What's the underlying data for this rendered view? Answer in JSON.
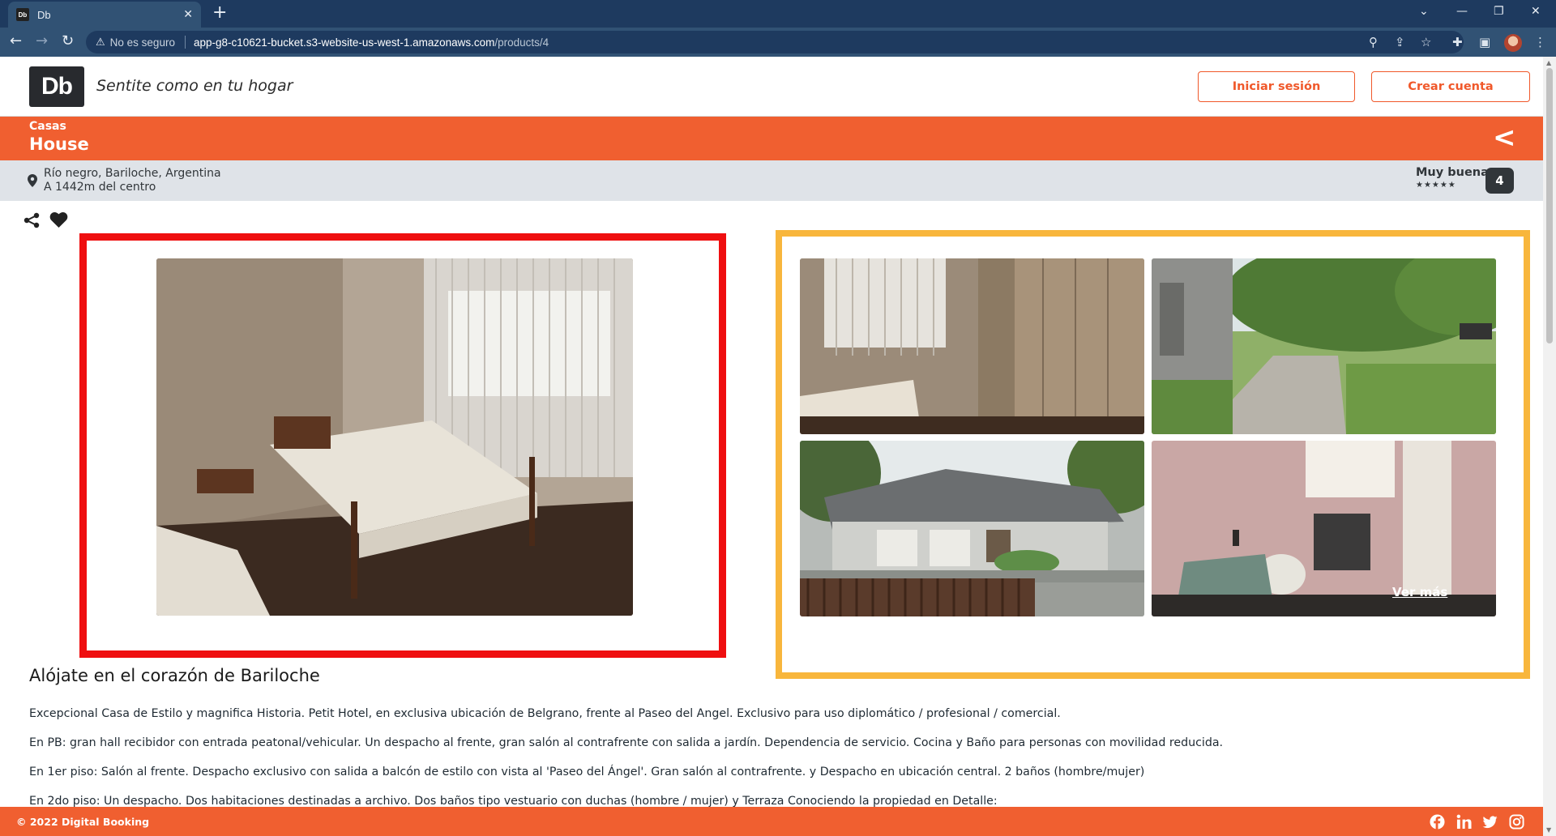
{
  "browser": {
    "tab_title": "Db",
    "tab_favicon": "Db",
    "new_tab_label": "+",
    "security_label": "No es seguro",
    "url_host": "app-g8-c10621-bucket.s3-website-us-west-1.amazonaws.com",
    "url_path": "/products/4"
  },
  "header": {
    "logo_text": "Db",
    "slogan": "Sentite como en tu hogar",
    "login_label": "Iniciar sesión",
    "signup_label": "Crear cuenta"
  },
  "product": {
    "category": "Casas",
    "name": "House",
    "location_line1": "Río negro, Bariloche, Argentina",
    "location_line2": "A 1442m del centro",
    "rating_text": "Muy buena",
    "stars": "★★★★★",
    "score": "4"
  },
  "gallery": {
    "more_label": "Ver más"
  },
  "description": {
    "title": "Alójate en el corazón de Bariloche",
    "paragraphs": [
      "Excepcional Casa de Estilo y magnifica Historia. Petit Hotel, en exclusiva ubicación de Belgrano, frente al Paseo del Angel. Exclusivo para uso diplomático / profesional / comercial.",
      "En PB: gran hall recibidor con entrada peatonal/vehicular. Un despacho al frente, gran salón al contrafrente con salida a jardín. Dependencia de servicio. Cocina y Baño para personas con movilidad reducida.",
      "En 1er piso: Salón al frente. Despacho exclusivo con salida a balcón de estilo con vista al 'Paseo del Ángel'. Gran salón al contrafrente. y Despacho en ubicación central. 2 baños (hombre/mujer)",
      "En 2do piso: Un despacho. Dos habitaciones destinadas a archivo. Dos baños tipo vestuario con duchas (hombre / mujer) y Terraza Conociendo la propiedad en Detalle:"
    ]
  },
  "footer": {
    "copyright": "© 2022 Digital Booking"
  },
  "colors": {
    "brand_orange": "#f05f30",
    "main_frame_red": "#ef0f10",
    "gallery_frame_yellow": "#f8b63c",
    "dark": "#31363a"
  }
}
